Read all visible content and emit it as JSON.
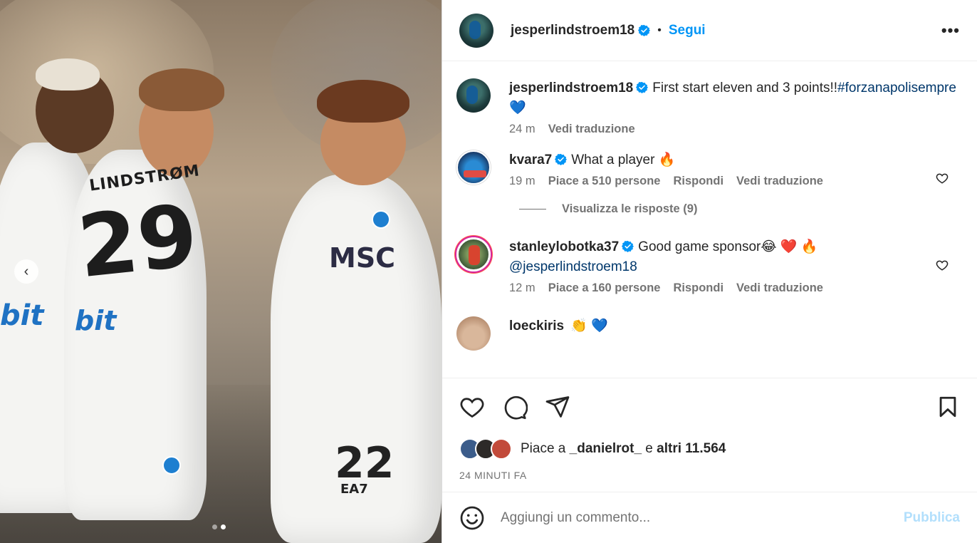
{
  "post": {
    "author": "jesperlindstroem18",
    "follow_label": "Segui",
    "separator": "•",
    "more_label": "•••",
    "caption_text": "First start eleven and 3 points!!",
    "caption_hashtag": "#forzanapolisempre",
    "caption_emoji": "💙",
    "caption_time": "24 m",
    "caption_translate": "Vedi traduzione"
  },
  "media": {
    "number_left": "29",
    "number_right": "22",
    "jersey_name": "LINDSTRØM",
    "sponsor_left": "bit",
    "sponsor_chest": "MSC",
    "kit_brand": "EA7",
    "carousel_prev": "‹",
    "dots": [
      false,
      true
    ]
  },
  "comments": [
    {
      "user": "kvara7",
      "text": "What a player",
      "emoji": "🔥",
      "time": "19 m",
      "likes": "Piace a 510 persone",
      "reply": "Rispondi",
      "translate": "Vedi traduzione",
      "view_replies": "Visualizza le risposte (9)"
    },
    {
      "user": "stanleylobotka37",
      "text": "Good game sponsor",
      "emoji": "😂 ❤️ 🔥",
      "mention": "@jesperlindstroem18",
      "time": "12 m",
      "likes": "Piace a 160 persone",
      "reply": "Rispondi",
      "translate": "Vedi traduzione"
    },
    {
      "user": "loeckiris",
      "emoji": "👏 💙"
    }
  ],
  "likes": {
    "prefix": "Piace a ",
    "user": "_danielrot_",
    "middle": " e ",
    "others": "altri 11.564"
  },
  "timestamp": "24 MINUTI FA",
  "add_comment": {
    "emoji_icon": "smile-icon",
    "placeholder": "Aggiungi un commento...",
    "publish_label": "Pubblica"
  },
  "colors": {
    "accent": "#0095f6",
    "verified": "#0095f6",
    "publish_disabled": "#b2dffc",
    "secondary_text": "#737373"
  }
}
